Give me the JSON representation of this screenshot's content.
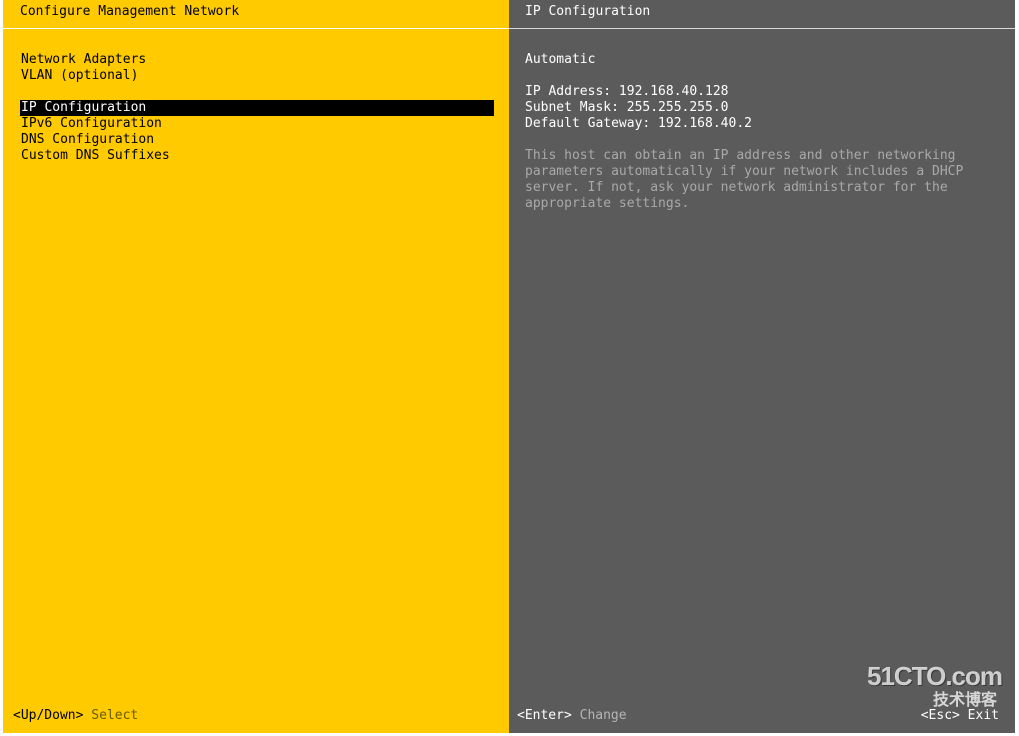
{
  "left_panel": {
    "title": "Configure Management Network",
    "menu": [
      {
        "label": "Network Adapters"
      },
      {
        "label": "VLAN (optional)"
      },
      {
        "label": ""
      },
      {
        "label": "IP Configuration",
        "selected": true
      },
      {
        "label": "IPv6 Configuration"
      },
      {
        "label": "DNS Configuration"
      },
      {
        "label": "Custom DNS Suffixes"
      }
    ],
    "footer_key": "<Up/Down>",
    "footer_action": "Select"
  },
  "right_panel": {
    "title": "IP Configuration",
    "mode": "Automatic",
    "ip_address": "IP Address: 192.168.40.128",
    "subnet_mask": "Subnet Mask: 255.255.255.0",
    "default_gateway": "Default Gateway: 192.168.40.2",
    "description": [
      "This host can obtain an IP address and other networking",
      "parameters automatically if your network includes a DHCP",
      "server. If not, ask your network administrator for the",
      "appropriate settings."
    ],
    "footer_key": "<Enter>",
    "footer_action": "Change",
    "esc_hint": "<Esc> Exit"
  },
  "watermark": {
    "brand": "51CTO.com",
    "subtitle": "技术博客"
  },
  "colors": {
    "left_bg": "#ffcb00",
    "right_bg": "#5b5b5b",
    "selection_bg": "#000000"
  }
}
